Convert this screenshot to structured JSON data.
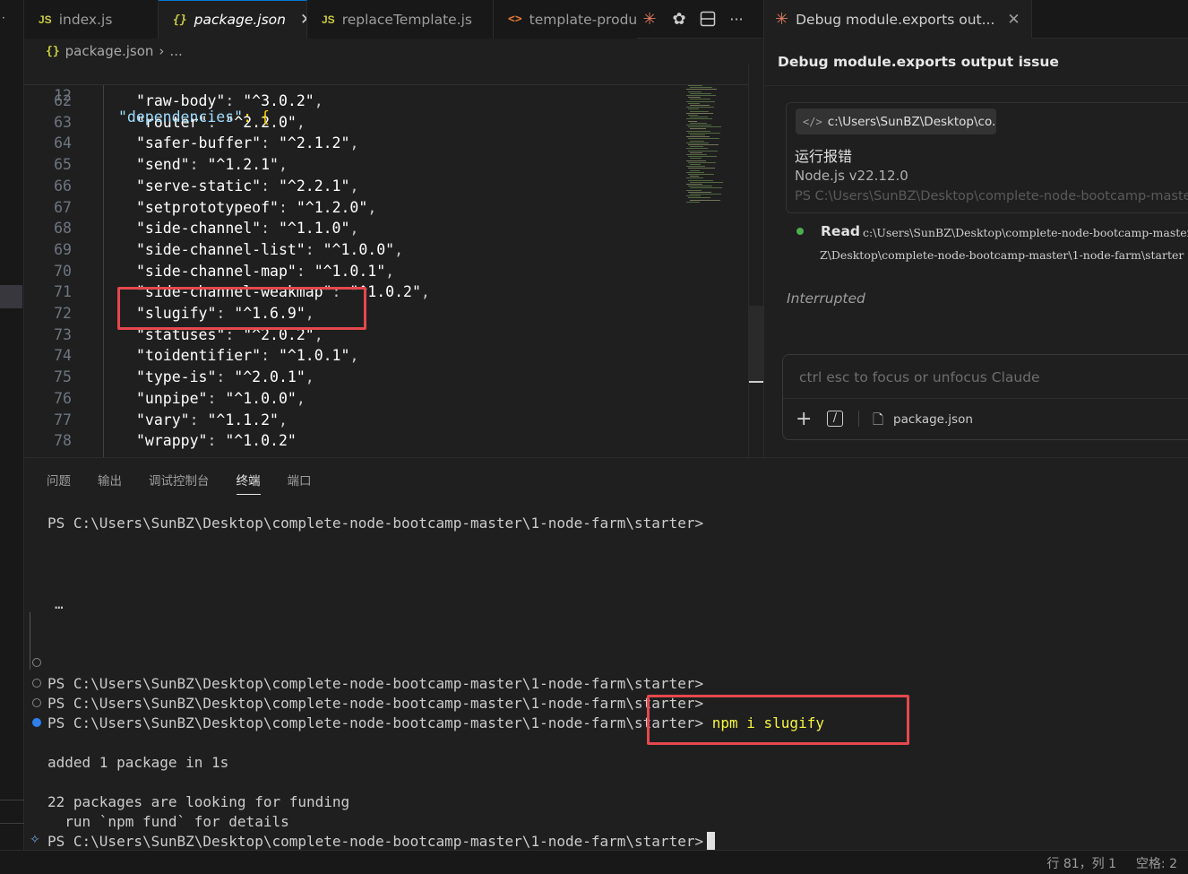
{
  "editor_tabs": [
    {
      "icon": "JS",
      "label": "index.js",
      "active": false
    },
    {
      "icon": "{}",
      "label": "package.json",
      "active": true
    },
    {
      "icon": "JS",
      "label": "replaceTemplate.js",
      "active": false
    },
    {
      "icon": "<>",
      "label": "template-produ",
      "active": false
    }
  ],
  "toolbar": {
    "icons": [
      "claude-spark-icon",
      "openai-icon",
      "split-editor-icon",
      "more-icon"
    ],
    "more": "···"
  },
  "breadcrumb": {
    "file": "package.json",
    "sep": "›",
    "rest": "..."
  },
  "sticky": {
    "line": "12",
    "key": "\"dependencies\"",
    "rest": ": {"
  },
  "code_lines": [
    {
      "n": "62",
      "k": "\"raw-body\"",
      "v": "\"^3.0.2\"",
      "end": ","
    },
    {
      "n": "63",
      "k": "\"router\"",
      "v": "\"^2.2.0\"",
      "end": ","
    },
    {
      "n": "64",
      "k": "\"safer-buffer\"",
      "v": "\"^2.1.2\"",
      "end": ","
    },
    {
      "n": "65",
      "k": "\"send\"",
      "v": "\"^1.2.1\"",
      "end": ","
    },
    {
      "n": "66",
      "k": "\"serve-static\"",
      "v": "\"^2.2.1\"",
      "end": ","
    },
    {
      "n": "67",
      "k": "\"setprototypeof\"",
      "v": "\"^1.2.0\"",
      "end": ","
    },
    {
      "n": "68",
      "k": "\"side-channel\"",
      "v": "\"^1.1.0\"",
      "end": ","
    },
    {
      "n": "69",
      "k": "\"side-channel-list\"",
      "v": "\"^1.0.0\"",
      "end": ","
    },
    {
      "n": "70",
      "k": "\"side-channel-map\"",
      "v": "\"^1.0.1\"",
      "end": ","
    },
    {
      "n": "71",
      "k": "\"side-channel-weakmap\"",
      "v": "\"^1.0.2\"",
      "end": ","
    },
    {
      "n": "72",
      "k": "\"slugify\"",
      "v": "\"^1.6.9\"",
      "end": ","
    },
    {
      "n": "73",
      "k": "\"statuses\"",
      "v": "\"^2.0.2\"",
      "end": ","
    },
    {
      "n": "74",
      "k": "\"toidentifier\"",
      "v": "\"^1.0.1\"",
      "end": ","
    },
    {
      "n": "75",
      "k": "\"type-is\"",
      "v": "\"^2.0.1\"",
      "end": ","
    },
    {
      "n": "76",
      "k": "\"unpipe\"",
      "v": "\"^1.0.0\"",
      "end": ","
    },
    {
      "n": "77",
      "k": "\"vary\"",
      "v": "\"^1.1.2\"",
      "end": ","
    },
    {
      "n": "78",
      "k": "\"wrappy\"",
      "v": "\"^1.0.2\"",
      "end": ""
    }
  ],
  "panel": {
    "tabs": [
      "问题",
      "输出",
      "调试控制台",
      "终端",
      "端口"
    ],
    "active_tab": "终端"
  },
  "terminal": {
    "prompt": "PS C:\\Users\\SunBZ\\Desktop\\complete-node-bootcamp-master\\1-node-farm\\starter>",
    "ellipsis": "…",
    "command": "npm i slugify",
    "out1": "added 1 package in 1s",
    "out2": "22 packages are looking for funding",
    "out3": "  run `npm fund` for details"
  },
  "status": {
    "position": "行 81，列 1",
    "spaces": "空格: 2"
  },
  "side": {
    "tab_label": "Debug module.exports out...",
    "title": "Debug module.exports output issue",
    "file_chip": "c:\\Users\\SunBZ\\Desktop\\co...",
    "message": "运行报错",
    "node_version": "Node.js v22.12.0",
    "faded": "PS C:\\Users\\SunBZ\\Desktop\\complete-node-bootcamp-master",
    "read_label": "Read",
    "read_path": "c:\\Users\\SunBZ\\Desktop\\complete-node-bootcamp-master",
    "read_path2": "Z\\Desktop\\complete-node-bootcamp-master\\1-node-farm\\starter",
    "interrupted": "Interrupted",
    "composer_placeholder": "ctrl esc to focus or unfocus Claude",
    "composer_file": "package.json"
  },
  "colors": {
    "highlight_box": "#e5484d",
    "accent": "#0078d4",
    "json_key": "#9cdcfe",
    "json_string": "#ce9178"
  }
}
